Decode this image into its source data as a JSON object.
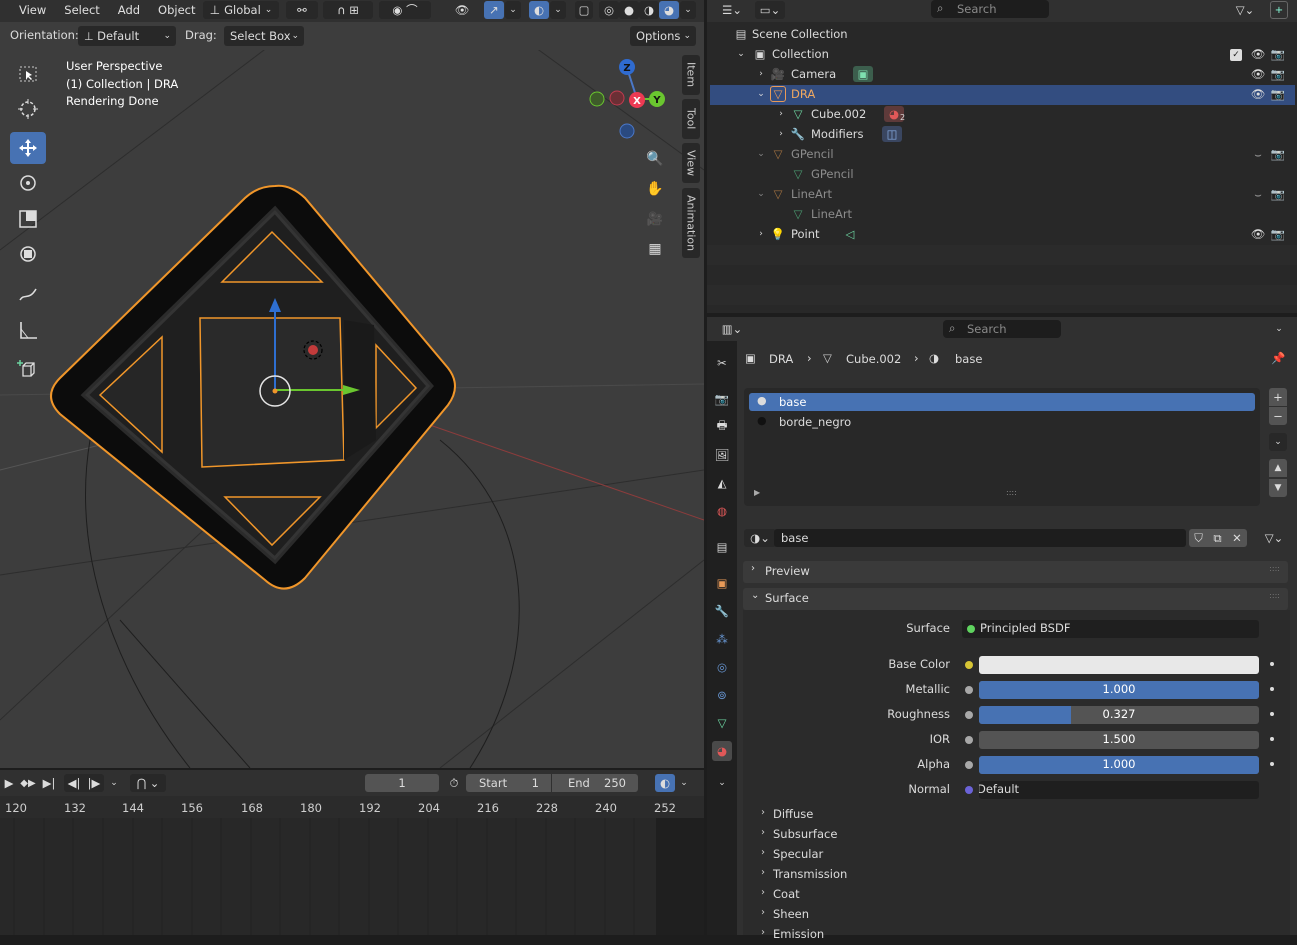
{
  "viewport": {
    "menu": [
      "View",
      "Select",
      "Add",
      "Object"
    ],
    "transform_orientation": "Global",
    "orientation_label": "Orientation:",
    "orientation_value": "Default",
    "drag_label": "Drag:",
    "drag_value": "Select Box",
    "options_label": "Options",
    "overlay_text": [
      "User Perspective",
      "(1) Collection | DRA",
      "Rendering Done"
    ],
    "gizmo": {
      "z": "Z",
      "x": "X",
      "y": "Y"
    },
    "side_tabs": [
      "Item",
      "Tool",
      "View",
      "Animation"
    ]
  },
  "timeline": {
    "current_frame": "1",
    "start_label": "Start",
    "start_value": "1",
    "end_label": "End",
    "end_value": "250",
    "ruler": [
      "120",
      "132",
      "144",
      "156",
      "168",
      "180",
      "192",
      "204",
      "216",
      "228",
      "240",
      "252"
    ]
  },
  "outliner": {
    "search_placeholder": "Search",
    "scene_collection": "Scene Collection",
    "items": [
      {
        "label": "Collection"
      },
      {
        "label": "Camera"
      },
      {
        "label": "DRA"
      },
      {
        "label": "Cube.002",
        "badge": "2"
      },
      {
        "label": "Modifiers"
      },
      {
        "label": "GPencil"
      },
      {
        "label": "GPencil"
      },
      {
        "label": "LineArt"
      },
      {
        "label": "LineArt"
      },
      {
        "label": "Point"
      }
    ]
  },
  "properties": {
    "search_placeholder": "Search",
    "breadcrumb": [
      "DRA",
      "Cube.002",
      "base"
    ],
    "material_slots": [
      "base",
      "borde_negro"
    ],
    "material_name": "base",
    "panels": {
      "preview": "Preview",
      "surface": "Surface"
    },
    "surface": {
      "surface_label": "Surface",
      "surface_value": "Principled BSDF",
      "base_color_label": "Base Color",
      "metallic_label": "Metallic",
      "metallic_value": "1.000",
      "metallic_fill": 1.0,
      "roughness_label": "Roughness",
      "roughness_value": "0.327",
      "roughness_fill": 0.327,
      "ior_label": "IOR",
      "ior_value": "1.500",
      "alpha_label": "Alpha",
      "alpha_value": "1.000",
      "alpha_fill": 1.0,
      "normal_label": "Normal",
      "normal_value": "Default"
    },
    "subpanels": [
      "Diffuse",
      "Subsurface",
      "Specular",
      "Transmission",
      "Coat",
      "Sheen",
      "Emission"
    ]
  },
  "colors": {
    "accent": "#4772b3",
    "selection_outline": "#f0962a",
    "header": "#303030"
  }
}
